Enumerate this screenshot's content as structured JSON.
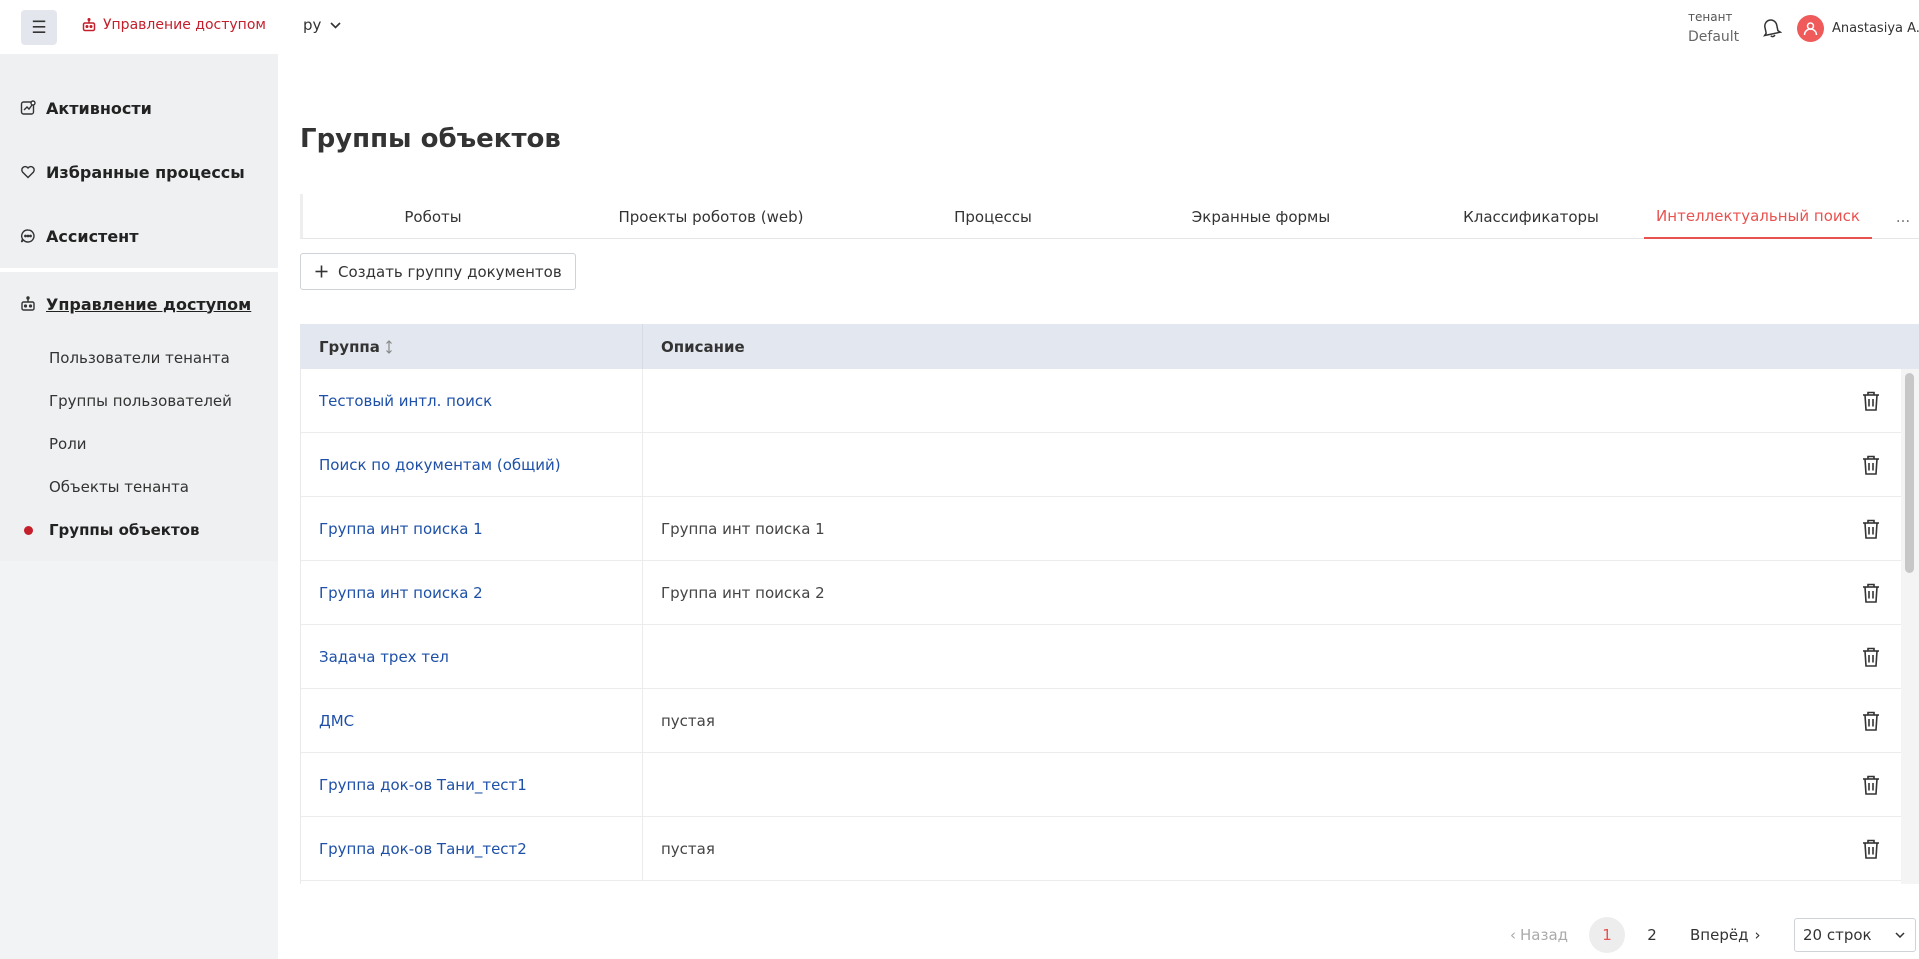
{
  "header": {
    "app_title": "Управление доступом",
    "language": "ру",
    "tenant_label": "тенант",
    "tenant_name": "Default",
    "user_name": "Anastasiya A."
  },
  "sidebar": {
    "items": [
      {
        "label": "Активности",
        "icon": "activity-icon"
      },
      {
        "label": "Избранные процессы",
        "icon": "heart-icon"
      },
      {
        "label": "Ассистент",
        "icon": "chat-icon"
      },
      {
        "label": "Управление доступом",
        "icon": "robot-icon"
      }
    ],
    "subitems": [
      "Пользователи тенанта",
      "Группы пользователей",
      "Роли",
      "Объекты тенанта",
      "Группы объектов"
    ]
  },
  "main": {
    "title": "Группы объектов",
    "tabs": [
      "Роботы",
      "Проекты роботов (web)",
      "Процессы",
      "Экранные формы",
      "Классификаторы",
      "Интеллектуальный поиск",
      "..."
    ],
    "create_button": "Создать группу документов",
    "columns": {
      "group": "Группа",
      "description": "Описание"
    },
    "rows": [
      {
        "group": "Тестовый интл. поиск",
        "description": ""
      },
      {
        "group": "Поиск по документам (общий)",
        "description": ""
      },
      {
        "group": "Группа инт поиска 1",
        "description": "Группа инт поиска 1"
      },
      {
        "group": "Группа инт поиска 2",
        "description": "Группа инт поиска 2"
      },
      {
        "group": "Задача трех тел",
        "description": ""
      },
      {
        "group": "ДМС",
        "description": "пустая"
      },
      {
        "group": "Группа док-ов Тани_тест1",
        "description": ""
      },
      {
        "group": "Группа док-ов Тани_тест2",
        "description": "пустая"
      }
    ]
  },
  "pagination": {
    "prev": "Назад",
    "pages": [
      "1",
      "2"
    ],
    "current": "1",
    "next": "Вперёд",
    "rows_per_page": "20 строк"
  },
  "colors": {
    "accent": "#e8524f",
    "brand": "#c3202c",
    "link": "#1e50a8"
  }
}
